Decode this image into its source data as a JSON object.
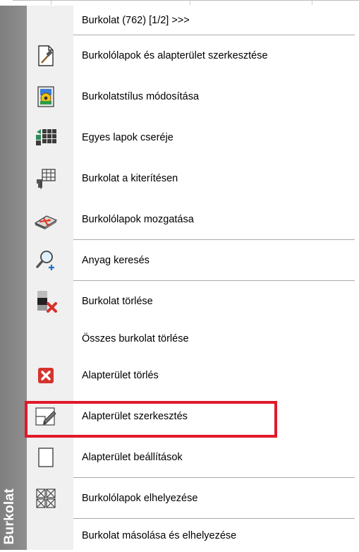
{
  "panel": {
    "title": "Burkolat"
  },
  "menu": {
    "items": [
      {
        "label": "Burkolat (762) [1/2] >>>",
        "icon": ""
      },
      {
        "label": "Burkolólapok és alapterület szerkesztése",
        "icon": "edit-hammer-icon"
      },
      {
        "label": "Burkolatstílus módosítása",
        "icon": "style-icon"
      },
      {
        "label": "Egyes lapok cseréje",
        "icon": "tile-replace-icon"
      },
      {
        "label": "Burkolat a kiterítésen",
        "icon": "grid-unfold-icon"
      },
      {
        "label": "Burkolólapok mozgatása",
        "icon": "move-tiles-icon"
      },
      {
        "label": "Anyag keresés",
        "icon": "search-material-icon"
      },
      {
        "label": "Burkolat törlése",
        "icon": "delete-tiling-icon"
      },
      {
        "label": "Összes burkolat törlése",
        "icon": ""
      },
      {
        "label": "Alapterület törlés",
        "icon": "delete-area-icon"
      },
      {
        "label": "Alapterület szerkesztés",
        "icon": "edit-area-icon"
      },
      {
        "label": "Alapterület beállítások",
        "icon": "area-settings-icon"
      },
      {
        "label": "Burkolólapok elhelyezése",
        "icon": "place-tiles-icon"
      },
      {
        "label": "Burkolat másolása és elhelyezése",
        "icon": ""
      }
    ],
    "highlighted_item": "Alapterület szerkesztés"
  },
  "colors": {
    "highlight": "#e0192a",
    "panel_stripe": "#8a8a8a",
    "icon_column": "#f0f0f0"
  }
}
